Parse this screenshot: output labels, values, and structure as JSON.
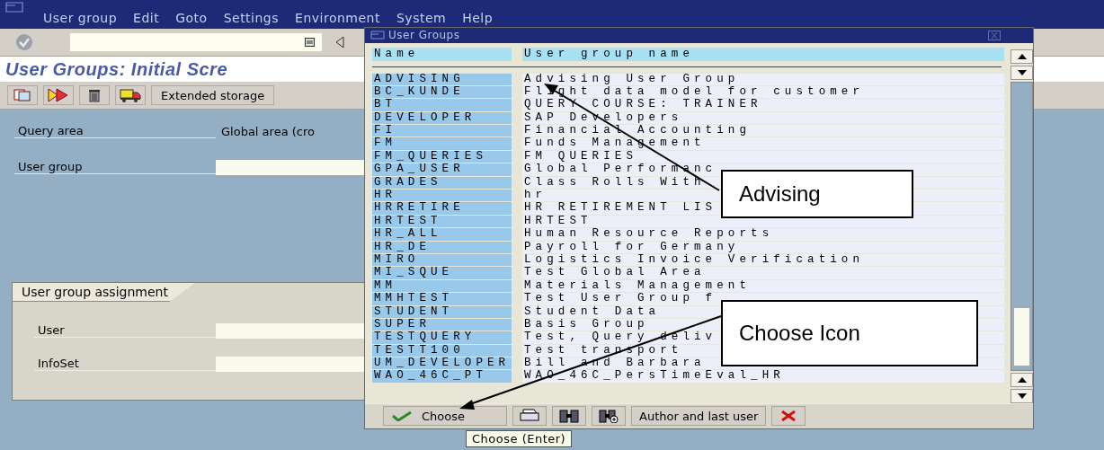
{
  "menu": [
    "User group",
    "Edit",
    "Goto",
    "Settings",
    "Environment",
    "System",
    "Help"
  ],
  "title": "User Groups: Initial Scre",
  "app_toolbar": {
    "extended_button": "Extended storage"
  },
  "query_area": {
    "label": "Query area",
    "value": "Global area (cro"
  },
  "user_group": {
    "label": "User group"
  },
  "assignment": {
    "title": "User group assignment",
    "fields": [
      {
        "label": "User"
      },
      {
        "label": "InfoSet"
      }
    ]
  },
  "dialog": {
    "title": "User Groups",
    "columns": [
      "Name",
      "User group name"
    ],
    "rows": [
      {
        "name": "ADVISING",
        "description": "Advising User Group"
      },
      {
        "name": "BC_KUNDE",
        "description": "Flight data model for customer"
      },
      {
        "name": "BT",
        "description": "QUERY COURSE: TRAINER"
      },
      {
        "name": "DEVELOPER",
        "description": "SAP Developers"
      },
      {
        "name": "FI",
        "description": "Financial Accounting"
      },
      {
        "name": "FM",
        "description": "Funds Management"
      },
      {
        "name": "FM_QUERIES",
        "description": "FM QUERIES"
      },
      {
        "name": "GPA_USER",
        "description": "Global Performanc"
      },
      {
        "name": "GRADES",
        "description": "Class Rolls With"
      },
      {
        "name": "HR",
        "description": "hr"
      },
      {
        "name": "HRRETIRE",
        "description": "HR RETIREMENT LIS"
      },
      {
        "name": "HRTEST",
        "description": "HRTEST"
      },
      {
        "name": "HR_ALL",
        "description": "Human Resource Reports"
      },
      {
        "name": "HR_DE",
        "description": "Payroll for Germany"
      },
      {
        "name": "MIRO",
        "description": "Logistics Invoice Verification"
      },
      {
        "name": "MI_SQUE",
        "description": "Test Global Area"
      },
      {
        "name": "MM",
        "description": "Materials Management"
      },
      {
        "name": "MMHTEST",
        "description": "Test User Group f"
      },
      {
        "name": "STUDENT",
        "description": "Student Data"
      },
      {
        "name": "SUPER",
        "description": "Basis Group"
      },
      {
        "name": "TESTQUERY",
        "description": "Test, Query deliv"
      },
      {
        "name": "TESTT100",
        "description": "Test transport"
      },
      {
        "name": "UM_DEVELOPER",
        "description": "Bill and Barbara"
      },
      {
        "name": "WAO_46C_PT",
        "description": "WAO_46C_PersTimeEval_HR"
      }
    ],
    "buttons": {
      "choose": "Choose",
      "author": "Author and last user"
    },
    "tooltip": "Choose (Enter)"
  },
  "callouts": [
    {
      "text": "Advising"
    },
    {
      "text": "Choose Icon"
    }
  ]
}
